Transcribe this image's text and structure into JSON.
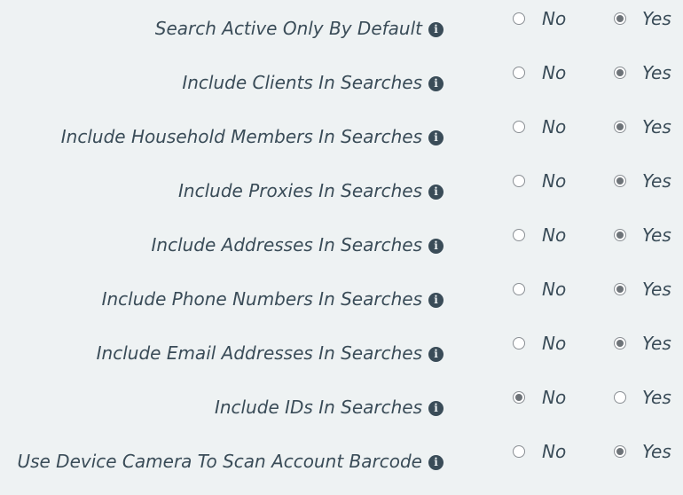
{
  "options": {
    "no_label": "No",
    "yes_label": "Yes"
  },
  "info_glyph": "i",
  "settings": [
    {
      "label": "Search Active Only By Default",
      "selected": "Yes"
    },
    {
      "label": "Include Clients In Searches",
      "selected": "Yes"
    },
    {
      "label": "Include Household Members In Searches",
      "selected": "Yes"
    },
    {
      "label": "Include Proxies In Searches",
      "selected": "Yes"
    },
    {
      "label": "Include Addresses In Searches",
      "selected": "Yes"
    },
    {
      "label": "Include Phone Numbers In Searches",
      "selected": "Yes"
    },
    {
      "label": "Include Email Addresses In Searches",
      "selected": "Yes"
    },
    {
      "label": "Include IDs In Searches",
      "selected": "No"
    },
    {
      "label": "Use Device Camera To Scan Account Barcode",
      "selected": "Yes"
    }
  ]
}
